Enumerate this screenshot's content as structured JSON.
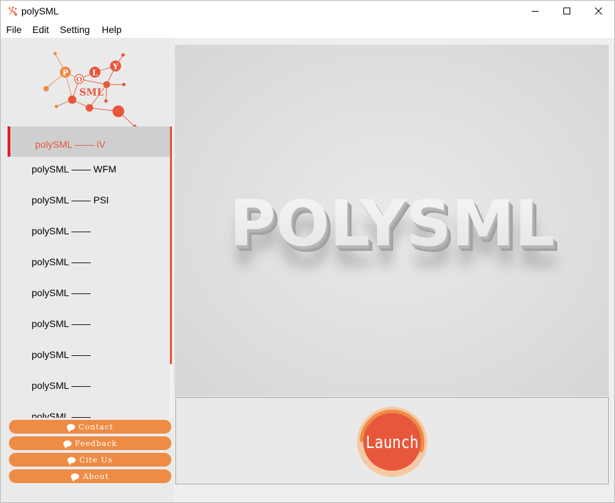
{
  "window": {
    "title": "polySML",
    "minimize_icon": "minimize-icon",
    "maximize_icon": "maximize-icon",
    "close_icon": "close-icon"
  },
  "menu": [
    "File",
    "Edit",
    "Setting",
    "Help"
  ],
  "logo": {
    "letters": [
      "P",
      "O",
      "L",
      "Y"
    ],
    "text": "SML"
  },
  "nav_items": [
    {
      "label": "polySML —— iV",
      "active": true
    },
    {
      "label": "polySML —— WFM",
      "active": false
    },
    {
      "label": "polySML —— PSI",
      "active": false
    },
    {
      "label": "polySML ——",
      "active": false
    },
    {
      "label": "polySML ——",
      "active": false
    },
    {
      "label": "polySML ——",
      "active": false
    },
    {
      "label": "polySML ——",
      "active": false
    },
    {
      "label": "polySML ——",
      "active": false
    },
    {
      "label": "polySML ——",
      "active": false
    },
    {
      "label": "polySML ——",
      "active": false
    }
  ],
  "side_buttons": [
    {
      "label": "Contact",
      "icon": "speech-bubble-icon"
    },
    {
      "label": "Feedback",
      "icon": "speech-bubble-icon"
    },
    {
      "label": "Cite Us",
      "icon": "speech-bubble-icon"
    },
    {
      "label": "About",
      "icon": "speech-bubble-icon"
    }
  ],
  "banner": {
    "text": "POLYSML"
  },
  "launch": {
    "label": "Launch"
  },
  "colors": {
    "accent": "#e8573c",
    "orange": "#ee8c45",
    "active_bar": "#e01f1f",
    "light_orange": "#f5c9a4"
  }
}
